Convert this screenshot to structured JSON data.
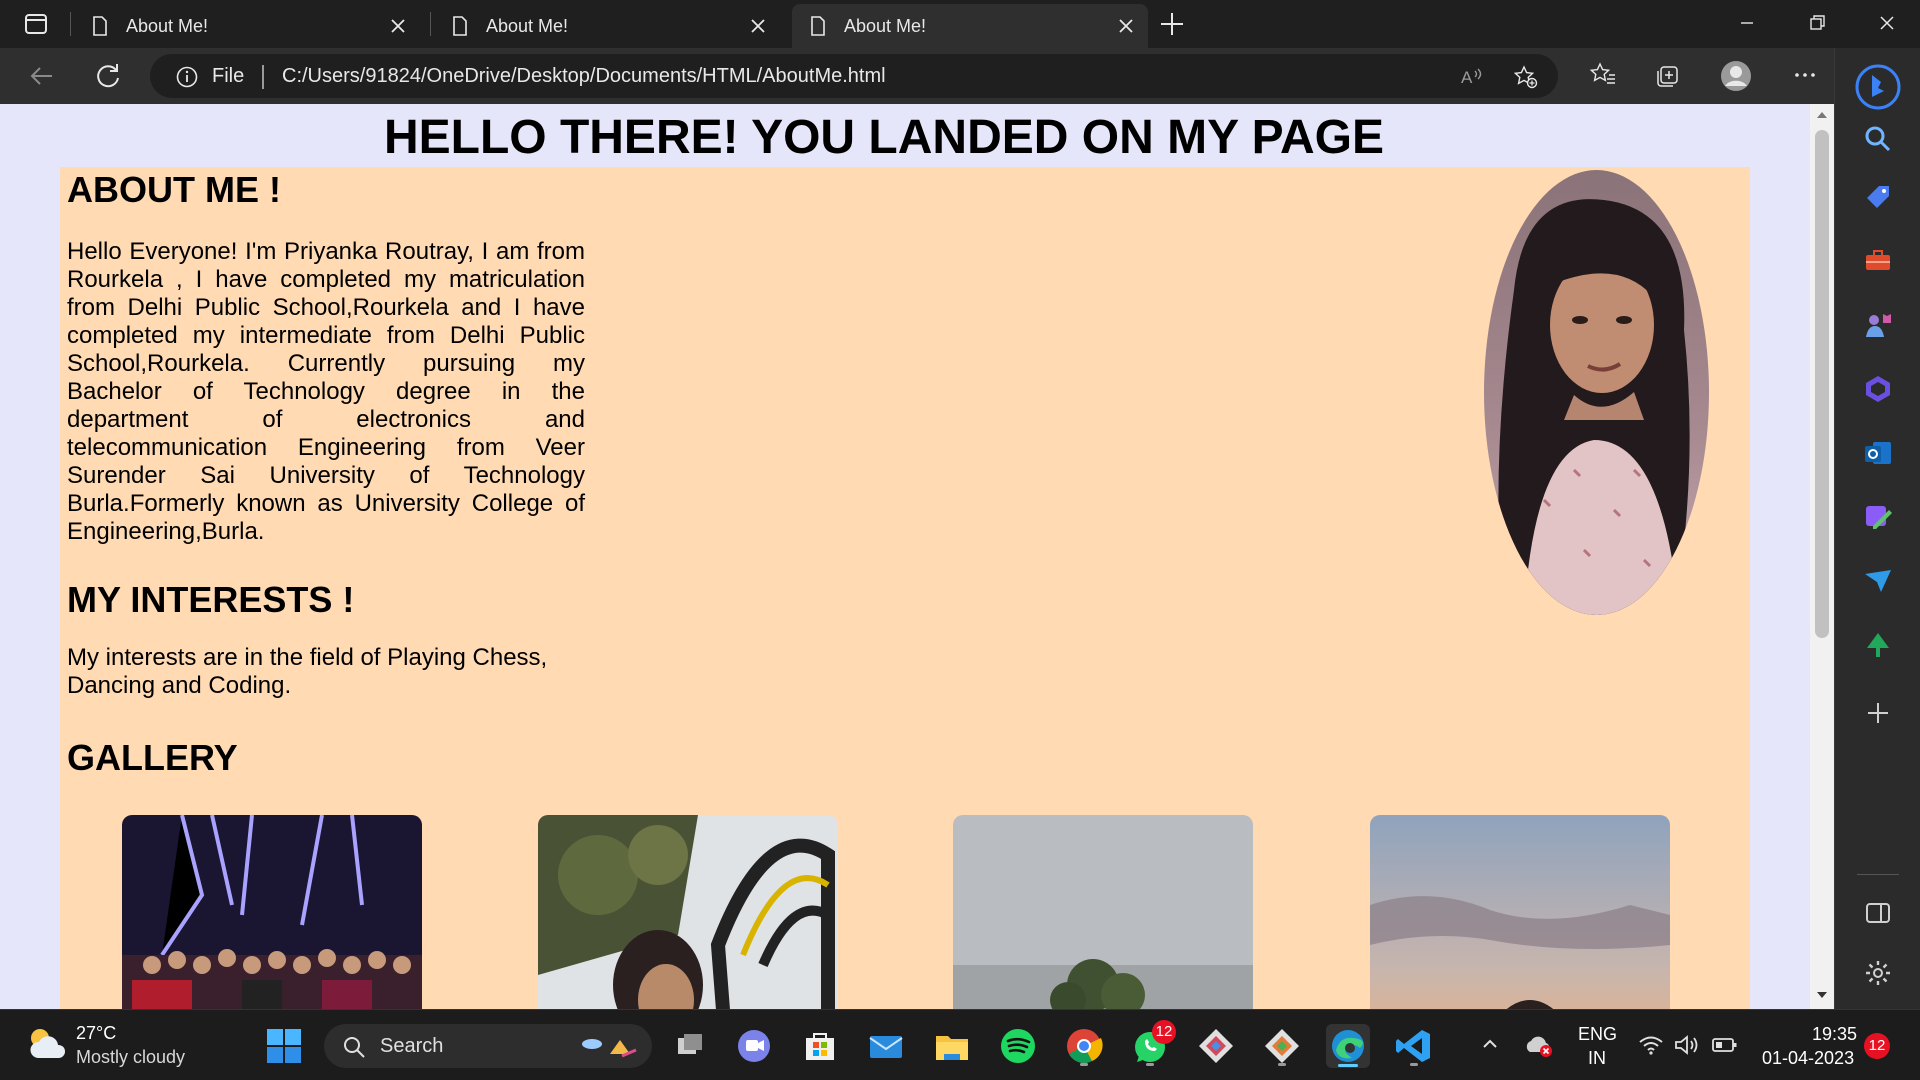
{
  "browser": {
    "tabs": [
      {
        "title": "About Me!",
        "active": false
      },
      {
        "title": "About Me!",
        "active": false
      },
      {
        "title": "About Me!",
        "active": true
      }
    ],
    "address": {
      "scheme_label": "File",
      "url": "C:/Users/91824/OneDrive/Desktop/Documents/HTML/AboutMe.html"
    }
  },
  "page": {
    "heading": "HELLO THERE! YOU LANDED ON MY PAGE",
    "about": {
      "title": "ABOUT ME !",
      "text": "Hello Everyone! I'm Priyanka Routray, I am from Rourkela , I have completed my matriculation from Delhi Public School,Rourkela and I have completed my intermediate from Delhi Public School,Rourkela. Currently pursuing my Bachelor of Technology degree in the department of electronics and telecommunication Engineering from Veer Surender Sai University of Technology Burla.Formerly known as University College of Engineering,Burla."
    },
    "interests": {
      "title": "MY INTERESTS !",
      "text": "My interests are in the field of Playing Chess, Dancing and Coding."
    },
    "gallery": {
      "title": "GALLERY"
    },
    "colors": {
      "page_background": "#e6e6fa",
      "content_background": "#ffdab3",
      "text": "#000000"
    }
  },
  "taskbar": {
    "weather": {
      "temp": "27°C",
      "condition": "Mostly cloudy"
    },
    "search_label": "Search",
    "whatsapp_badge": "12",
    "language": {
      "line1": "ENG",
      "line2": "IN"
    },
    "clock": {
      "time": "19:35",
      "date": "01-04-2023"
    },
    "notification_count": "12"
  }
}
